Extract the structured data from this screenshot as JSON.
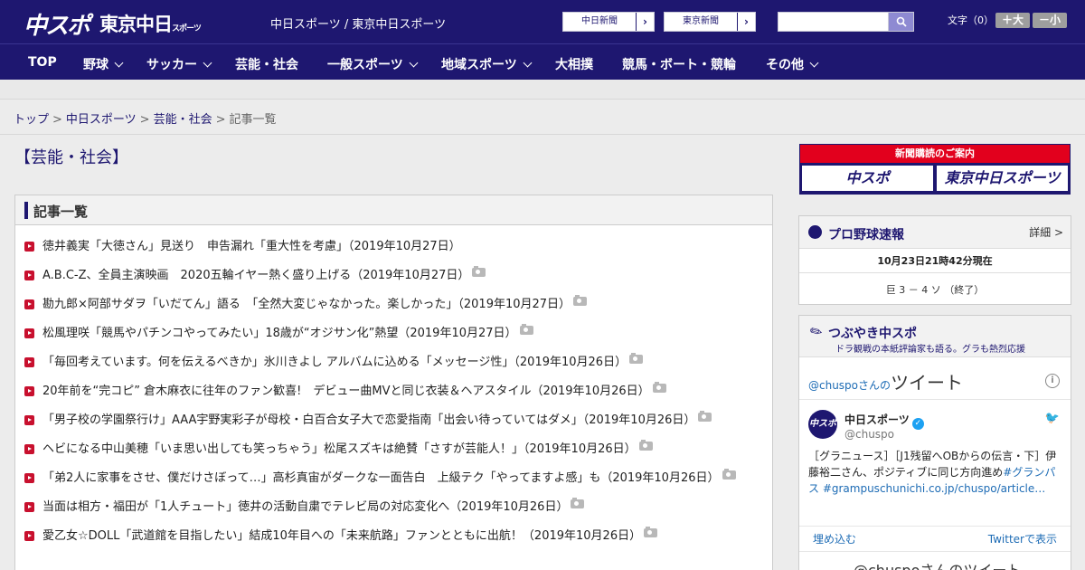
{
  "header": {
    "logo_chuspo": "中スポ",
    "logo_tokyo": "東京中日",
    "logo_tokyo_sub": "スポーツ",
    "site_title": "中日スポーツ / 東京中日スポーツ",
    "link_chunichi": "中日新聞",
    "link_tokyo": "東京新聞",
    "search_placeholder": "",
    "font_label": "文字（0）",
    "font_bigger": "＋大",
    "font_smaller": "－小"
  },
  "nav": {
    "items": [
      {
        "label": "TOP",
        "dropdown": false
      },
      {
        "label": "野球",
        "dropdown": true
      },
      {
        "label": "サッカー",
        "dropdown": true
      },
      {
        "label": "芸能・社会",
        "dropdown": false
      },
      {
        "label": "一般スポーツ",
        "dropdown": true
      },
      {
        "label": "地域スポーツ",
        "dropdown": true
      },
      {
        "label": "大相撲",
        "dropdown": false
      },
      {
        "label": "競馬・ボート・競輪",
        "dropdown": false
      },
      {
        "label": "その他",
        "dropdown": true
      }
    ]
  },
  "breadcrumb": {
    "items": [
      "トップ",
      "中日スポーツ",
      "芸能・社会"
    ],
    "current": "記事一覧"
  },
  "page": {
    "title": "【芸能・社会】",
    "list_heading": "記事一覧"
  },
  "articles": [
    {
      "title": "徳井義実「大徳さん」見送り　申告漏れ「重大性を考慮」（2019年10月27日）",
      "photo": false
    },
    {
      "title": "A.B.C-Z、全員主演映画　2020五輪イヤー熱く盛り上げる（2019年10月27日）",
      "photo": true
    },
    {
      "title": "勘九郎×阿部サダヲ「いだてん」語る　「全然大変じゃなかった。楽しかった」（2019年10月27日）",
      "photo": true
    },
    {
      "title": "松風理咲「競馬やパチンコやってみたい」18歳が“オジサン化”熱望（2019年10月27日）",
      "photo": true
    },
    {
      "title": "「毎回考えています。何を伝えるべきか」氷川きよし アルバムに込める「メッセージ性」（2019年10月26日）",
      "photo": true
    },
    {
      "title": "20年前を“完コピ” 倉木麻衣に往年のファン歓喜!　デビュー曲MVと同じ衣装＆ヘアスタイル（2019年10月26日）",
      "photo": true
    },
    {
      "title": "「男子校の学園祭行け」AAA宇野実彩子が母校・白百合女子大で恋愛指南「出会い待っていてはダメ」（2019年10月26日）",
      "photo": true
    },
    {
      "title": "ヘビになる中山美穂「いま思い出しても笑っちゃう」松尾スズキは絶賛「さすが芸能人！」（2019年10月26日）",
      "photo": true
    },
    {
      "title": "「弟2人に家事をさせ、僕だけさぼって…」高杉真宙がダークな一面告白　上級テク「やってますよ感」も（2019年10月26日）",
      "photo": true
    },
    {
      "title": "当面は相方・福田が「1人チュート」徳井の活動自粛でテレビ局の対応変化へ（2019年10月26日）",
      "photo": true
    },
    {
      "title": "愛乙女☆DOLL「武道館を目指したい」結成10年目への「未来航路」ファンとともに出航！（2019年10月26日）",
      "photo": true
    }
  ],
  "subscribe": {
    "banner": "新聞購読のご案内",
    "logo1": "中スポ",
    "logo2": "東京中日スポーツ"
  },
  "baseball": {
    "title": "プロ野球速報",
    "detail": "詳細 >",
    "timestamp": "10月23日21時42分現在",
    "score": "巨 3 － 4 ソ （終了）"
  },
  "tweets": {
    "title": "つぶやき中スポ",
    "subtitle": "ドラ観戦の本紙評論家も語る。グラも熱烈応援",
    "widget_prefix": "@chuspoさんの",
    "widget_title": "ツイート",
    "info": "i",
    "avatar": "中スポ",
    "name": "中日スポーツ",
    "handle": "@chuspo",
    "text_plain": "［グラニュース］［J1残留へOBからの伝言・下］伊藤裕二さん、ポジティブに同じ方向進め",
    "text_link": "#グランパス #grampuschunichi.co.jp/chuspo/article…",
    "embed": "埋め込む",
    "view_on_twitter": "Twitterで表示",
    "more": "@chuspoさんのツイート"
  },
  "colors": {
    "brand_navy": "#1e1770",
    "accent_red": "#c8102e",
    "banner_red": "#e2001d",
    "link_blue": "#1e6cb5"
  }
}
